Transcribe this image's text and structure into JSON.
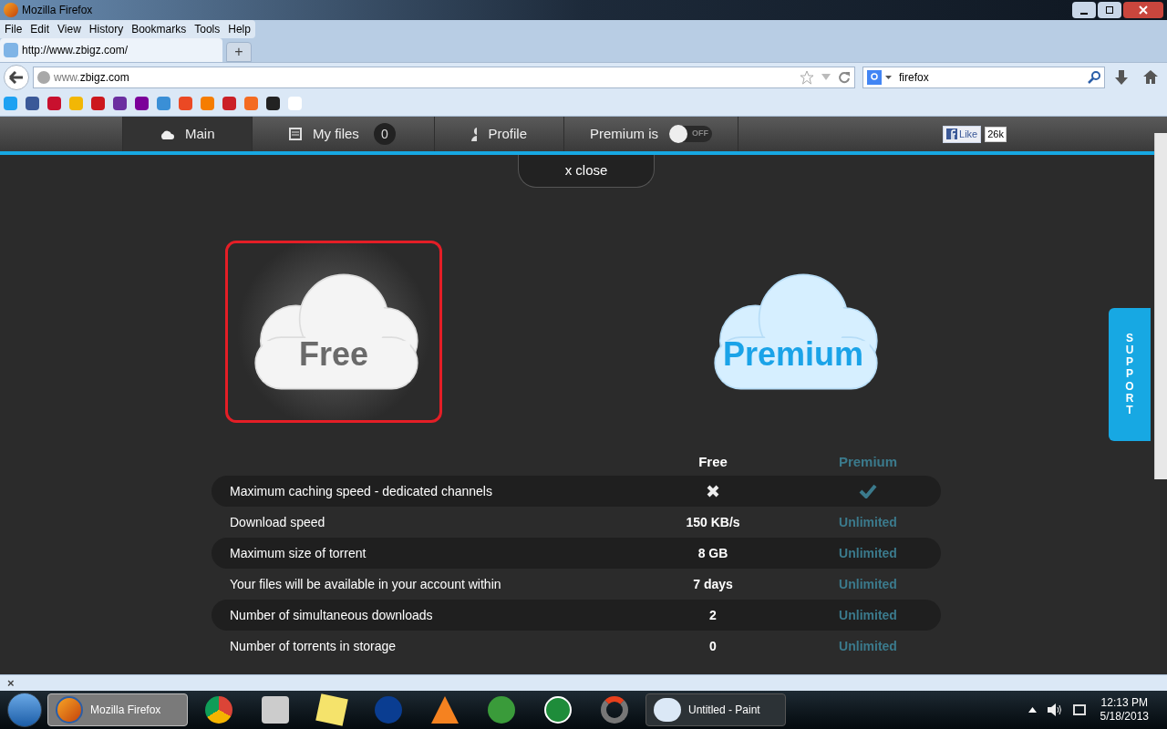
{
  "window": {
    "title": "Mozilla Firefox"
  },
  "menu": [
    "File",
    "Edit",
    "View",
    "History",
    "Bookmarks",
    "Tools",
    "Help"
  ],
  "tab": {
    "title": "http://www.zbigz.com/",
    "new_tab": "+"
  },
  "address": {
    "host_prefix": "www.",
    "host": "zbigz.com"
  },
  "search": {
    "value": "firefox"
  },
  "site_nav": [
    {
      "label": "Main",
      "kind": "main",
      "selected": true
    },
    {
      "label": "My files",
      "kind": "files",
      "count": "0",
      "selected": false
    },
    {
      "label": "Profile",
      "kind": "profile",
      "selected": false
    }
  ],
  "premium_toggle": {
    "label": "Premium is",
    "state": "OFF",
    "on": false
  },
  "like": {
    "label": "Like",
    "count": "26k"
  },
  "close": "x close",
  "plans": [
    {
      "label": "Free",
      "kind": "free",
      "selected": true
    },
    {
      "label": "Premium",
      "kind": "premium",
      "selected": false
    }
  ],
  "table": {
    "columns": [
      "Free",
      "Premium"
    ],
    "rows": [
      {
        "feature": "Maximum caching speed - dedicated channels",
        "free": {
          "kind": "cross"
        },
        "premium": {
          "kind": "check"
        }
      },
      {
        "feature": "Download speed",
        "free": {
          "kind": "text",
          "text": "150 KB/s"
        },
        "premium": {
          "kind": "text",
          "text": "Unlimited"
        }
      },
      {
        "feature": "Maximum size of torrent",
        "free": {
          "kind": "text",
          "text": "8 GB"
        },
        "premium": {
          "kind": "text",
          "text": "Unlimited"
        }
      },
      {
        "feature": "Your files will be available in your account within",
        "free": {
          "kind": "text",
          "text": "7 days"
        },
        "premium": {
          "kind": "text",
          "text": "Unlimited"
        }
      },
      {
        "feature": "Number of simultaneous downloads",
        "free": {
          "kind": "text",
          "text": "2"
        },
        "premium": {
          "kind": "text",
          "text": "Unlimited"
        }
      },
      {
        "feature": "Number of torrents in storage",
        "free": {
          "kind": "text",
          "text": "0"
        },
        "premium": {
          "kind": "text",
          "text": "Unlimited"
        }
      }
    ]
  },
  "support": "SUPPORT",
  "find_bar": {
    "close": "×"
  },
  "taskbar": {
    "buttons": [
      {
        "label": "Mozilla Firefox",
        "kind": "firefox",
        "selected": true
      },
      {
        "label": "Untitled - Paint",
        "kind": "paint",
        "selected": false
      }
    ],
    "time": "12:13 PM",
    "date": "5/18/2013"
  }
}
